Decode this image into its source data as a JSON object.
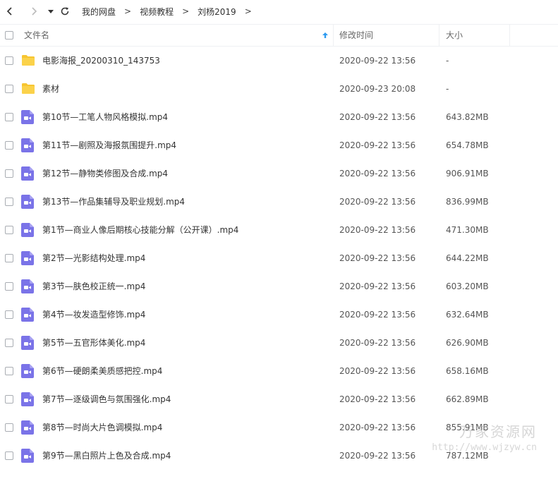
{
  "breadcrumbs": [
    "我的网盘",
    "视频教程",
    "刘杨2019"
  ],
  "breadcrumb_separator": ">",
  "columns": {
    "name": "文件名",
    "modified": "修改时间",
    "size": "大小"
  },
  "icons": {
    "back": "chevron-left-icon",
    "forward": "chevron-right-icon",
    "dropdown": "caret-down-icon",
    "refresh": "refresh-icon",
    "folder": "folder-icon",
    "video": "video-file-icon",
    "sort": "sort-ascending-icon"
  },
  "colors": {
    "folder": "#f7c531",
    "video": "#7a73e8",
    "sort_arrow": "#2e9bf0"
  },
  "files": [
    {
      "name": "电影海报_20200310_143753",
      "modified": "2020-09-22 13:56",
      "size": "-",
      "type": "folder"
    },
    {
      "name": "素材",
      "modified": "2020-09-23 20:08",
      "size": "-",
      "type": "folder"
    },
    {
      "name": "第10节—工笔人物风格模拟.mp4",
      "modified": "2020-09-22 13:56",
      "size": "643.82MB",
      "type": "video"
    },
    {
      "name": "第11节—剧照及海报氛围提升.mp4",
      "modified": "2020-09-22 13:56",
      "size": "654.78MB",
      "type": "video"
    },
    {
      "name": "第12节—静物类修图及合成.mp4",
      "modified": "2020-09-22 13:56",
      "size": "906.91MB",
      "type": "video"
    },
    {
      "name": "第13节—作品集辅导及职业规划.mp4",
      "modified": "2020-09-22 13:56",
      "size": "836.99MB",
      "type": "video"
    },
    {
      "name": "第1节—商业人像后期核心技能分解（公开课）.mp4",
      "modified": "2020-09-22 13:56",
      "size": "471.30MB",
      "type": "video"
    },
    {
      "name": "第2节—光影结构处理.mp4",
      "modified": "2020-09-22 13:56",
      "size": "644.22MB",
      "type": "video"
    },
    {
      "name": "第3节—肤色校正统一.mp4",
      "modified": "2020-09-22 13:56",
      "size": "603.20MB",
      "type": "video"
    },
    {
      "name": "第4节—妆发造型修饰.mp4",
      "modified": "2020-09-22 13:56",
      "size": "632.64MB",
      "type": "video"
    },
    {
      "name": "第5节—五官形体美化.mp4",
      "modified": "2020-09-22 13:56",
      "size": "626.90MB",
      "type": "video"
    },
    {
      "name": "第6节—硬朗柔美质感把控.mp4",
      "modified": "2020-09-22 13:56",
      "size": "658.16MB",
      "type": "video"
    },
    {
      "name": "第7节—逐级调色与氛围强化.mp4",
      "modified": "2020-09-22 13:56",
      "size": "662.89MB",
      "type": "video"
    },
    {
      "name": "第8节—时尚大片色调模拟.mp4",
      "modified": "2020-09-22 13:56",
      "size": "855.91MB",
      "type": "video"
    },
    {
      "name": "第9节—黑白照片上色及合成.mp4",
      "modified": "2020-09-22 13:56",
      "size": "787.12MB",
      "type": "video"
    }
  ],
  "watermark": {
    "title": "万家资源网",
    "url": "http://www.wjzyw.cn"
  }
}
